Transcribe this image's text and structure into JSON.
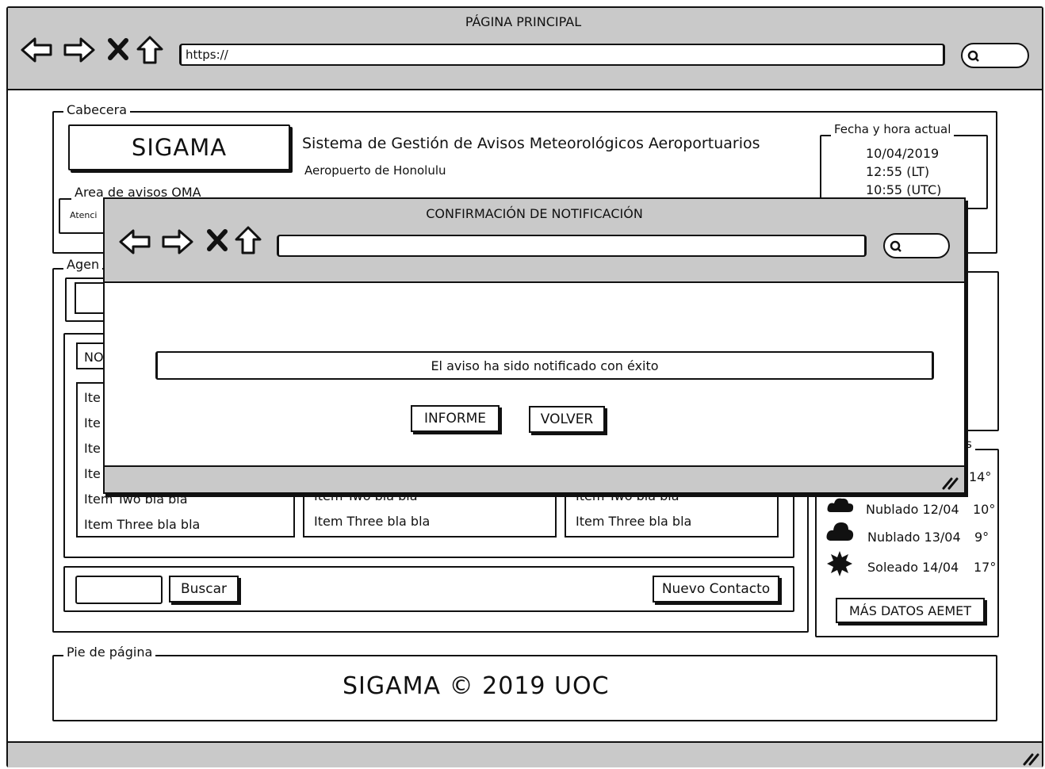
{
  "browser": {
    "title": "PÁGINA PRINCIPAL",
    "url": "https://"
  },
  "header": {
    "legend": "Cabecera",
    "logo": "SIGAMA",
    "system_name": "Sistema de Gestión de Avisos Meteorológicos Aeroportuarios",
    "airport": "Aeropuerto de Honolulu",
    "datetime": {
      "legend": "Fecha y hora actual",
      "date": "10/04/2019",
      "local_time": "12:55 (LT)",
      "utc_time": "10:55 (UTC)"
    },
    "oma": {
      "legend": "Area de avisos OMA",
      "text": "Atenci"
    }
  },
  "agenda": {
    "legend": "Agen",
    "tab_label": "NO",
    "lists": [
      {
        "items": [
          "Ite",
          "Ite",
          "Ite",
          "Ite",
          "Item Two bla bla",
          "Item Three bla bla"
        ]
      },
      {
        "items": [
          "Item Two bla bla",
          "Item Three bla bla"
        ]
      },
      {
        "items": [
          "Item Two bla bla",
          "Item Three bla bla"
        ]
      }
    ],
    "search_button": "Buscar",
    "new_contact_button": "Nuevo Contacto"
  },
  "weather": {
    "legend": "s",
    "forecast": [
      {
        "label": "",
        "temp": "14°",
        "icon": "cloud-icon"
      },
      {
        "label": "Nublado 12/04",
        "temp": "10°",
        "icon": "cloud-icon"
      },
      {
        "label": "Nublado 13/04",
        "temp": "9°",
        "icon": "cloud-icon"
      },
      {
        "label": "Soleado 14/04",
        "temp": "17°",
        "icon": "sun-icon"
      }
    ],
    "more_button": "MÁS DATOS AEMET"
  },
  "footer": {
    "legend": "Pie de página",
    "text": "SIGAMA © 2019 UOC"
  },
  "modal": {
    "title": "CONFIRMACIÓN DE NOTIFICACIÓN",
    "url": "",
    "message": "El aviso ha sido notificado con éxito",
    "report_button": "INFORME",
    "back_button": "VOLVER"
  }
}
